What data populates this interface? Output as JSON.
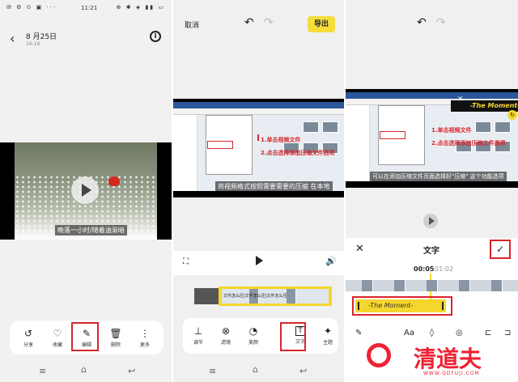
{
  "panel1": {
    "status": {
      "time": "11:21",
      "left_icons": "✉ ⚙ ⊙ ▣ ···",
      "right_icons": "⊕ ✱ ◈ ▮▮ ▭"
    },
    "header": {
      "date": "8 月25日",
      "time": "16:16"
    },
    "video": {
      "subtitle": "晚落一小时/随着油渐暗"
    },
    "toolbar": [
      {
        "icon": "↺",
        "label": "分享"
      },
      {
        "icon": "♡",
        "label": "收藏"
      },
      {
        "icon": "✎",
        "label": "编辑"
      },
      {
        "icon": "🗑",
        "label": "删除"
      },
      {
        "icon": "⋮",
        "label": "更多"
      }
    ]
  },
  "panel2": {
    "header": {
      "cancel": "取消",
      "export": "导出"
    },
    "screenshot": {
      "step1": "1.单击视频文件",
      "step2": "2.点击选择添加压缩文件选项",
      "subtitle": "将视频格式按照需要需要的压缩 在本地"
    },
    "clip_label": "文件怎么压|文件怎么压|文件怎么压",
    "toolbar": [
      {
        "icon": "⊥",
        "label": "调节"
      },
      {
        "icon": "⊗",
        "label": "滤镜"
      },
      {
        "icon": "◔",
        "label": "美颜"
      },
      {
        "icon": "T",
        "label": "文字"
      },
      {
        "icon": "✦",
        "label": "主题"
      }
    ]
  },
  "panel3": {
    "screenshot": {
      "step1": "1.单击视频文件",
      "step2": "2.点击选择添加压缩文件选项",
      "subtitle": "可以在添加压缩文件页面选择好\"压缩\" 这个功能选项",
      "moment": "-The Moment-"
    },
    "text_panel": {
      "title": "文字",
      "time_current": "00:05",
      "time_total": "01:02",
      "clip_label": "-The Moment-"
    },
    "tools": [
      "✎",
      "Aa",
      "◊",
      "◎",
      "⊏",
      "⊐"
    ]
  },
  "watermark": {
    "name": "清道夫",
    "url": "WWW.QDFUJI.COM"
  },
  "colors": {
    "accent_red": "#d9252a",
    "export_yellow": "#f7dd3c",
    "clip_yellow": "#f5d62c"
  }
}
